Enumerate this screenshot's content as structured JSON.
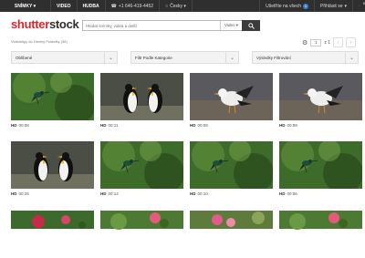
{
  "topbar": {
    "menu": "SNÍMKY ▾",
    "video": "VIDEO",
    "music": "HUDBA",
    "phone": "+1 646-419-4452",
    "language": "Česky ▾",
    "news_label": "Ušetříte na všech",
    "news_count": "1",
    "login": "Přihlásit se",
    "cart_count": "0"
  },
  "header": {
    "logo_main": "shutter",
    "logo_accent": "stock",
    "search_placeholder": "Hledat snímky, videa a další",
    "search_scope": "Video ▾"
  },
  "results": {
    "text": "Videoklipy do Deníky Postelky (39)"
  },
  "pager": {
    "page": "1",
    "of_text": "z 1"
  },
  "filters": [
    {
      "label": "Oblíbené"
    },
    {
      "label": "Filtr Podle Kategorie"
    },
    {
      "label": "Výsledky Filtrování"
    }
  ],
  "clips": [
    {
      "quality": "HD",
      "duration": "00:08",
      "scene": "hummingbird"
    },
    {
      "quality": "HD",
      "duration": "00:11",
      "scene": "penguins"
    },
    {
      "quality": "HD",
      "duration": "00:09",
      "scene": "gulls"
    },
    {
      "quality": "HD",
      "duration": "00:09",
      "scene": "gulls"
    },
    {
      "quality": "HD",
      "duration": "00:25",
      "scene": "penguins"
    },
    {
      "quality": "HD",
      "duration": "00:14",
      "scene": "hummingbird"
    },
    {
      "quality": "HD",
      "duration": "00:10",
      "scene": "hummingbird"
    },
    {
      "quality": "HD",
      "duration": "00:06",
      "scene": "hummingbird"
    },
    {
      "quality": "",
      "duration": "",
      "scene": "flowers-red"
    },
    {
      "quality": "",
      "duration": "",
      "scene": "flowers-green"
    },
    {
      "quality": "",
      "duration": "",
      "scene": "flowers-pink"
    },
    {
      "quality": "",
      "duration": "",
      "scene": "flowers-green"
    }
  ],
  "colors": {
    "brand": "#e2242b",
    "topbar": "#2f2f2f",
    "search_button": "#3b3b3b"
  }
}
